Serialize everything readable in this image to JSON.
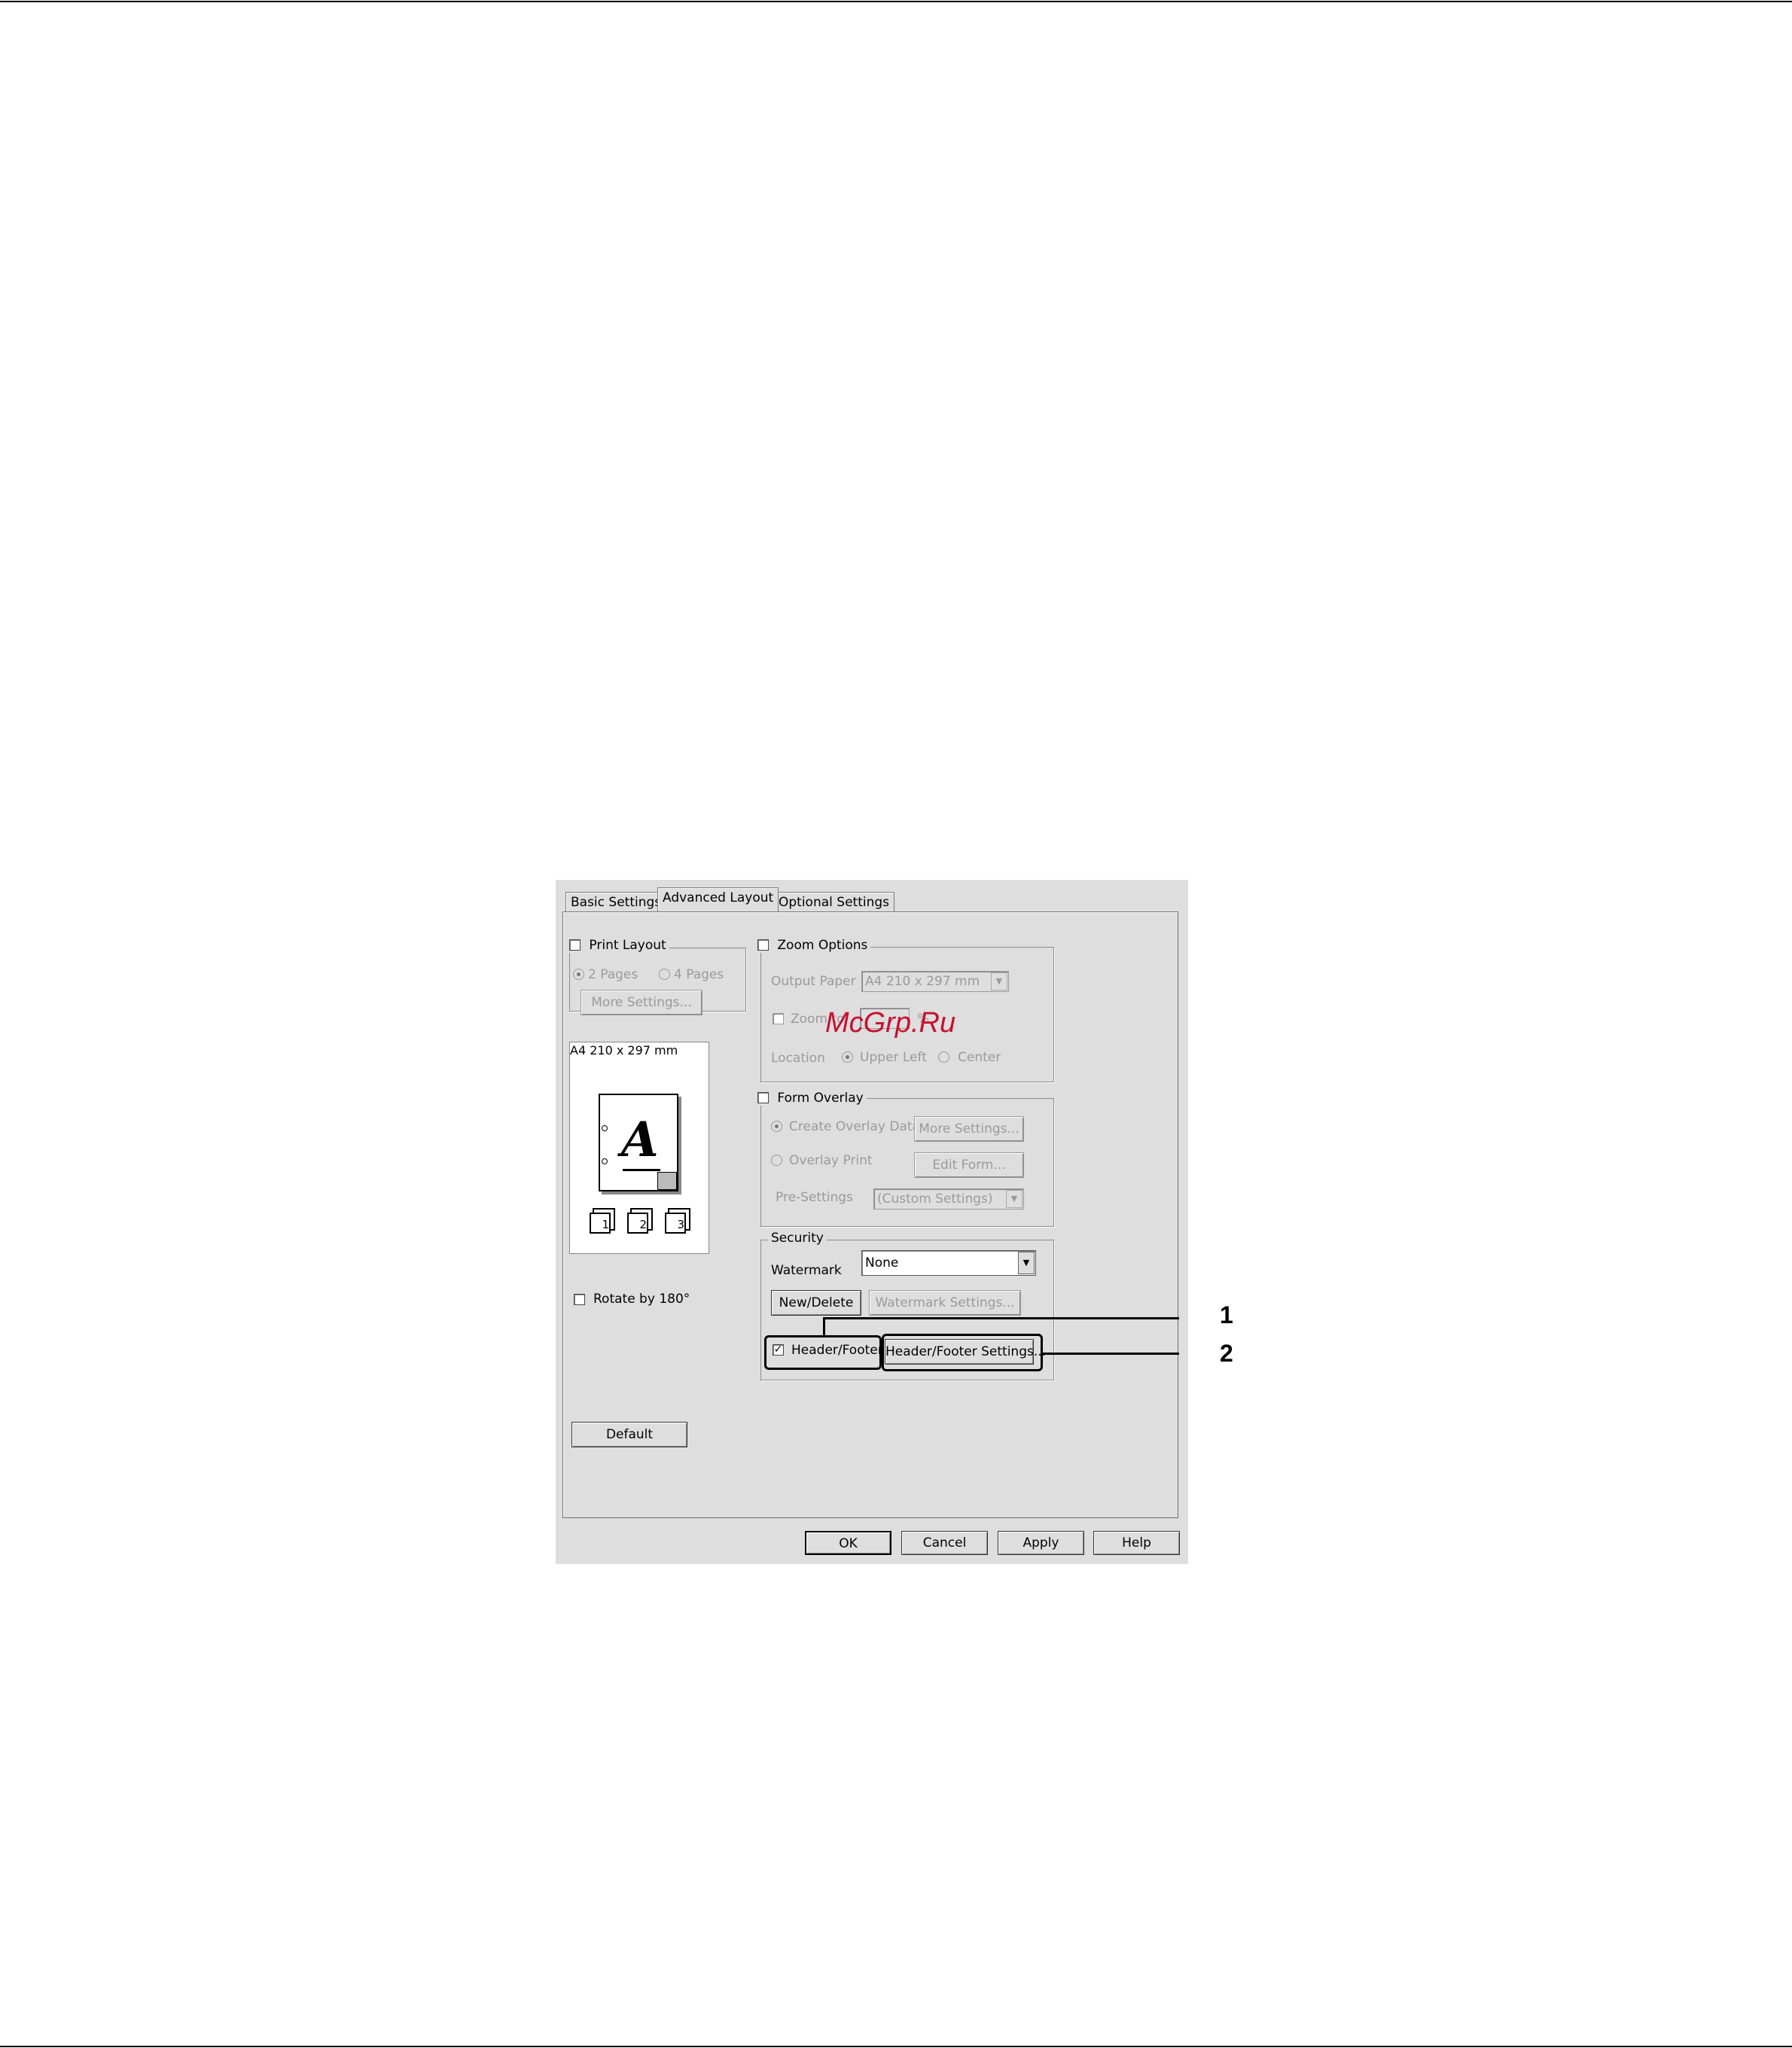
{
  "tabs": [
    "Basic Settings",
    "Advanced Layout",
    "Optional Settings"
  ],
  "print_layout": {
    "title": "Print Layout",
    "checked": false,
    "radio_2pages": "2 Pages",
    "radio_4pages": "4 Pages",
    "more_settings": "More Settings..."
  },
  "preview": {
    "paper": "A4 210 x 297 mm",
    "letter": "A",
    "stack_labels": [
      "1",
      "2",
      "3"
    ]
  },
  "rotate": {
    "label": "Rotate by 180°",
    "checked": false
  },
  "zoom_options": {
    "title": "Zoom Options",
    "output_paper_label": "Output Paper",
    "output_paper_value": "A4 210 x 297 mm",
    "zoom_to_label": "Zoom to",
    "percent": "%",
    "location_label": "Location",
    "upper_left": "Upper Left",
    "center": "Center"
  },
  "form_overlay": {
    "title": "Form Overlay",
    "create_overlay": "Create Overlay Data",
    "more_settings": "More Settings...",
    "overlay_print": "Overlay Print",
    "edit_form": "Edit Form...",
    "presettings_label": "Pre-Settings",
    "presettings_value": "(Custom Settings)"
  },
  "security": {
    "title": "Security",
    "watermark_label": "Watermark",
    "watermark_value": "None",
    "new_delete": "New/Delete",
    "watermark_settings": "Watermark Settings...",
    "header_footer": "Header/Footer",
    "header_footer_checked": true,
    "header_footer_settings": "Header/Footer Settings..."
  },
  "buttons": {
    "default": "Default",
    "ok": "OK",
    "cancel": "Cancel",
    "apply": "Apply",
    "help": "Help"
  },
  "callouts": [
    "1",
    "2"
  ],
  "watermark_text": "McGrp.Ru"
}
